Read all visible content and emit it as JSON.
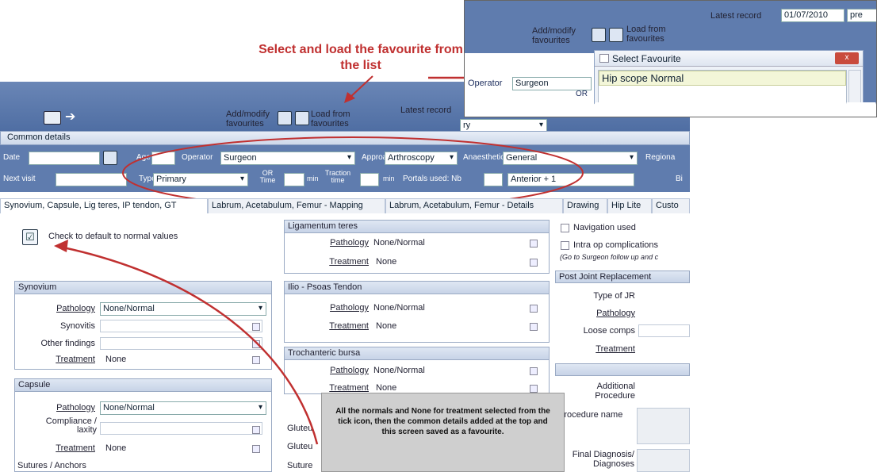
{
  "header": {
    "add_modify": "Add/modify favourites",
    "load_from": "Load from favourites",
    "latest_record_label": "Latest record",
    "latest_record_value": "ry"
  },
  "common_details": {
    "title": "Common details",
    "date_label": "Date",
    "age_label": "Age",
    "operator_label": "Operator",
    "operator_value": "Surgeon",
    "approach_label": "Approach",
    "approach_value": "Arthroscopy",
    "anaesthetic_label": "Anaesthetic",
    "anaesthetic_value": "General",
    "regional_label": "Regiona",
    "next_visit_label": "Next visit",
    "type_label": "Type",
    "type_value": "Primary",
    "or_time_label": "OR Time",
    "min1": "min",
    "traction_label": "Traction time",
    "min2": "min",
    "portals_label": "Portals used: Nb",
    "portals_value": "Anterior + 1",
    "bi_label": "Bi"
  },
  "tabs": [
    "Synovium, Capsule, Lig teres, IP tendon, GT",
    "Labrum, Acetabulum, Femur - Mapping",
    "Labrum, Acetabulum, Femur - Details",
    "Drawing",
    "Hip Lite",
    "Custo"
  ],
  "check_default": "Check to default to normal values",
  "synovium": {
    "title": "Synovium",
    "pathology_label": "Pathology",
    "pathology_value": "None/Normal",
    "synovitis_label": "Synovitis",
    "other_label": "Other findings",
    "treatment_label": "Treatment",
    "treatment_value": "None"
  },
  "capsule": {
    "title": "Capsule",
    "pathology_label": "Pathology",
    "pathology_value": "None/Normal",
    "compliance_label": "Compliance / laxity",
    "treatment_label": "Treatment",
    "treatment_value": "None",
    "sutures_label": "Sutures / Anchors"
  },
  "lig_teres": {
    "title": "Ligamentum teres",
    "pathology_label": "Pathology",
    "pathology_value": "None/Normal",
    "treatment_label": "Treatment",
    "treatment_value": "None"
  },
  "ilio": {
    "title": "Ilio - Psoas Tendon",
    "pathology_label": "Pathology",
    "pathology_value": "None/Normal",
    "treatment_label": "Treatment",
    "treatment_value": "None"
  },
  "troch": {
    "title": "Trochanteric bursa",
    "pathology_label": "Pathology",
    "pathology_value": "None/Normal",
    "treatment_label": "Treatment",
    "treatment_value": "None"
  },
  "gluteu1": "Gluteu",
  "gluteu2": "Gluteu",
  "suture": "Suture",
  "right": {
    "navigation": "Navigation used",
    "intra_op": "Intra op complications",
    "goto_note": "(Go to Surgeon follow up and c",
    "post_joint": "Post Joint Replacement",
    "type_jr": "Type of JR",
    "pathology": "Pathology",
    "loose": "Loose comps",
    "treatment": "Treatment",
    "additional": "Additional Procedure",
    "procedure_name": "Procedure name",
    "final_dx": "Final Diagnosis/ Diagnoses"
  },
  "callout": "All the normals and None for treatment selected from the tick icon, then the common details added at the top and this screen saved as a favourite.",
  "annotation": "Select and load the favourite from the list",
  "inset": {
    "latest_record_label": "Latest record",
    "latest_record_value": "01/07/2010",
    "prev": "pre",
    "add_modify": "Add/modify favourites",
    "load_from": "Load from favourites",
    "operator_label": "Operator",
    "operator_value": "Surgeon",
    "or_label": "OR",
    "dialog_title": "Select Favourite",
    "dialog_item": "Hip scope Normal",
    "close": "x"
  },
  "colors": {
    "header_blue": "#5f7cae",
    "accent_red": "#c03030"
  }
}
